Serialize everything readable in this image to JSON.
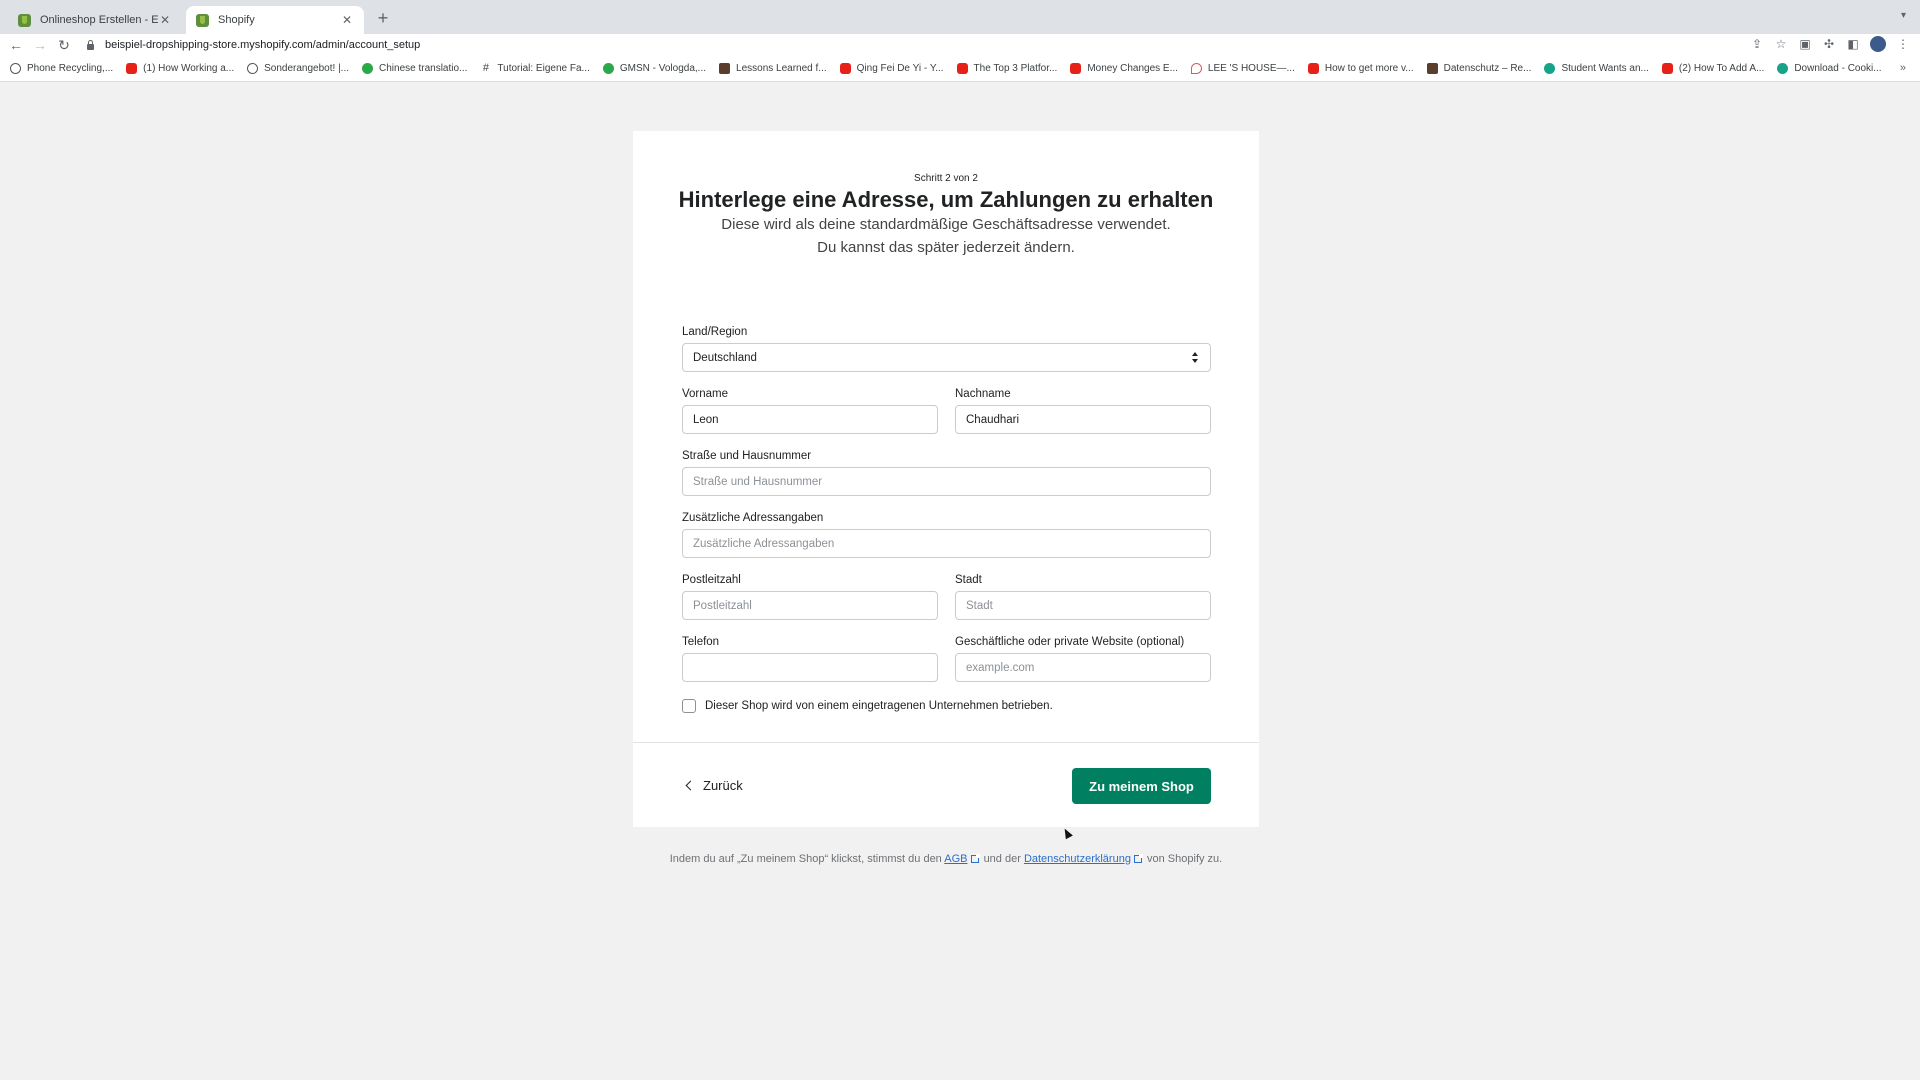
{
  "browser": {
    "tabs": [
      {
        "title": "Onlineshop Erstellen - Einfach"
      },
      {
        "title": "Shopify"
      }
    ],
    "url": "beispiel-dropshipping-store.myshopify.com/admin/account_setup",
    "bookmarks": [
      {
        "label": "Phone Recycling,...",
        "icon": "circle-icon"
      },
      {
        "label": "(1) How Working a...",
        "icon": "youtube-icon"
      },
      {
        "label": "Sonderangebot! |...",
        "icon": "circle-icon"
      },
      {
        "label": "Chinese translatio...",
        "icon": "green-icon"
      },
      {
        "label": "Tutorial: Eigene Fa...",
        "icon": "hash-icon"
      },
      {
        "label": "GMSN - Vologda,...",
        "icon": "green-icon"
      },
      {
        "label": "Lessons Learned f...",
        "icon": "dark-icon"
      },
      {
        "label": "Qing Fei De Yi - Y...",
        "icon": "youtube-icon"
      },
      {
        "label": "The Top 3 Platfor...",
        "icon": "youtube-icon"
      },
      {
        "label": "Money Changes E...",
        "icon": "youtube-icon"
      },
      {
        "label": "LEE 'S HOUSE—...",
        "icon": "airbnb-icon"
      },
      {
        "label": "How to get more v...",
        "icon": "youtube-icon"
      },
      {
        "label": "Datenschutz – Re...",
        "icon": "dark-icon"
      },
      {
        "label": "Student Wants an...",
        "icon": "teal-icon"
      },
      {
        "label": "(2) How To Add A...",
        "icon": "youtube-icon"
      },
      {
        "label": "Download - Cooki...",
        "icon": "teal-icon"
      }
    ]
  },
  "form": {
    "step": "Schritt 2 von 2",
    "title": "Hinterlege eine Adresse, um Zahlungen zu erhalten",
    "subtitle_line1": "Diese wird als deine standardmäßige Geschäftsadresse verwendet.",
    "subtitle_line2": "Du kannst das später jederzeit ändern.",
    "country_label": "Land/Region",
    "country_value": "Deutschland",
    "first_name_label": "Vorname",
    "first_name_value": "Leon",
    "last_name_label": "Nachname",
    "last_name_value": "Chaudhari",
    "street_label": "Straße und Hausnummer",
    "street_placeholder": "Straße und Hausnummer",
    "address2_label": "Zusätzliche Adressangaben",
    "address2_placeholder": "Zusätzliche Adressangaben",
    "zip_label": "Postleitzahl",
    "zip_placeholder": "Postleitzahl",
    "city_label": "Stadt",
    "city_placeholder": "Stadt",
    "phone_label": "Telefon",
    "website_label": "Geschäftliche oder private Website (optional)",
    "website_placeholder": "example.com",
    "checkbox_label": "Dieser Shop wird von einem eingetragenen Unternehmen betrieben.",
    "back_label": "Zurück",
    "submit_label": "Zu meinem Shop"
  },
  "legal": {
    "prefix": "Indem du auf „Zu meinem Shop“ klickst, stimmst du den",
    "agb": "AGB",
    "middle": "und der",
    "privacy": "Datenschutzerklärung",
    "suffix": "von Shopify zu."
  },
  "colors": {
    "primary": "#008060",
    "link": "#2c6ecb",
    "background": "#f1f1f1"
  }
}
